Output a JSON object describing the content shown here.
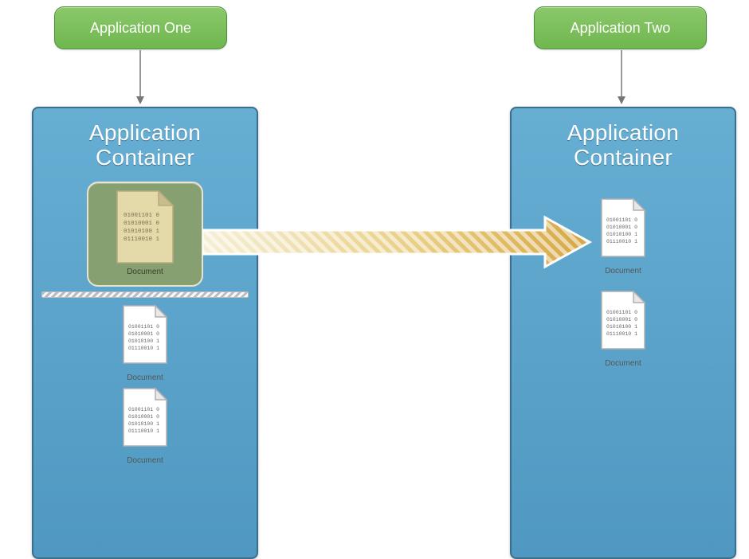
{
  "app1": {
    "label": "Application One"
  },
  "app2": {
    "label": "Application Two"
  },
  "container1": {
    "title": "Application\nContainer",
    "highlight_doc": "Document",
    "doc2": "Document",
    "doc3": "Document"
  },
  "container2": {
    "title": "Application\nContainer",
    "doc1": "Document",
    "doc2": "Document"
  },
  "binary_lines": [
    "01001101 0",
    "01010001 0",
    "01010100 1",
    "01110010 1"
  ],
  "colors": {
    "green_top": "#8bc86a",
    "green_bottom": "#6fb74f",
    "blue_top": "#67aed3",
    "blue_bottom": "#4f98c1",
    "olive": "#87a071",
    "arrow_gold": "#d6a644"
  }
}
